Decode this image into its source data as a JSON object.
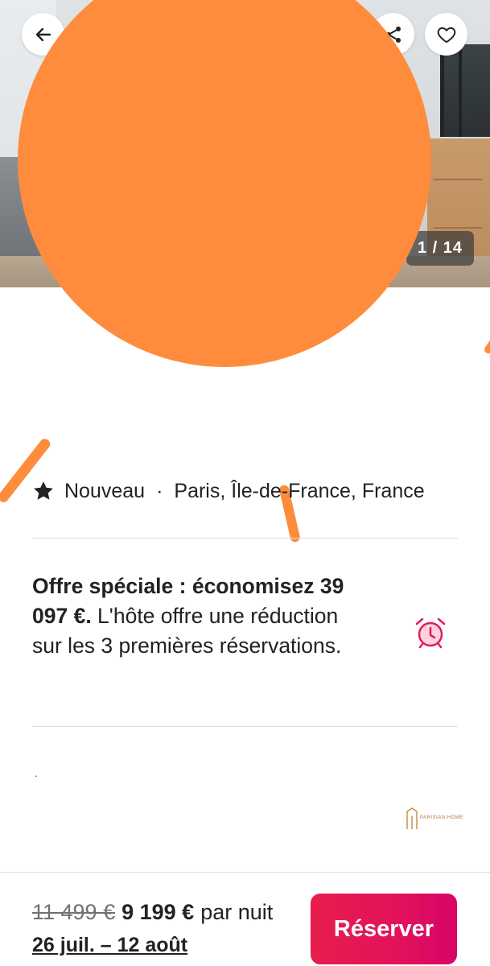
{
  "photo": {
    "counter_text": "1 / 14",
    "back_icon": "arrow-left-icon",
    "share_icon": "share-icon",
    "favorite_icon": "heart-outline-icon"
  },
  "listing": {
    "star_icon": "star-icon",
    "badge": "Nouveau",
    "separator": "·",
    "location": "Paris, Île-de-France, France"
  },
  "offer": {
    "title_bold": "Offre spéciale : économisez 39 097 €.",
    "description": " L'hôte offre une réduction sur les 3 premières réservations.",
    "icon": "alarm-clock-icon",
    "icon_color": "#e31c5f"
  },
  "misc": {
    "dot": "."
  },
  "host_logo": {
    "text": "PARISIAN HOME"
  },
  "booking_bar": {
    "old_price": "11 499 €",
    "new_price": "9 199 €",
    "per_night": "par nuit",
    "dates": "26 juil. – 12 août",
    "reserve_label": "Réserver",
    "reserve_color": "#e31c5f"
  }
}
